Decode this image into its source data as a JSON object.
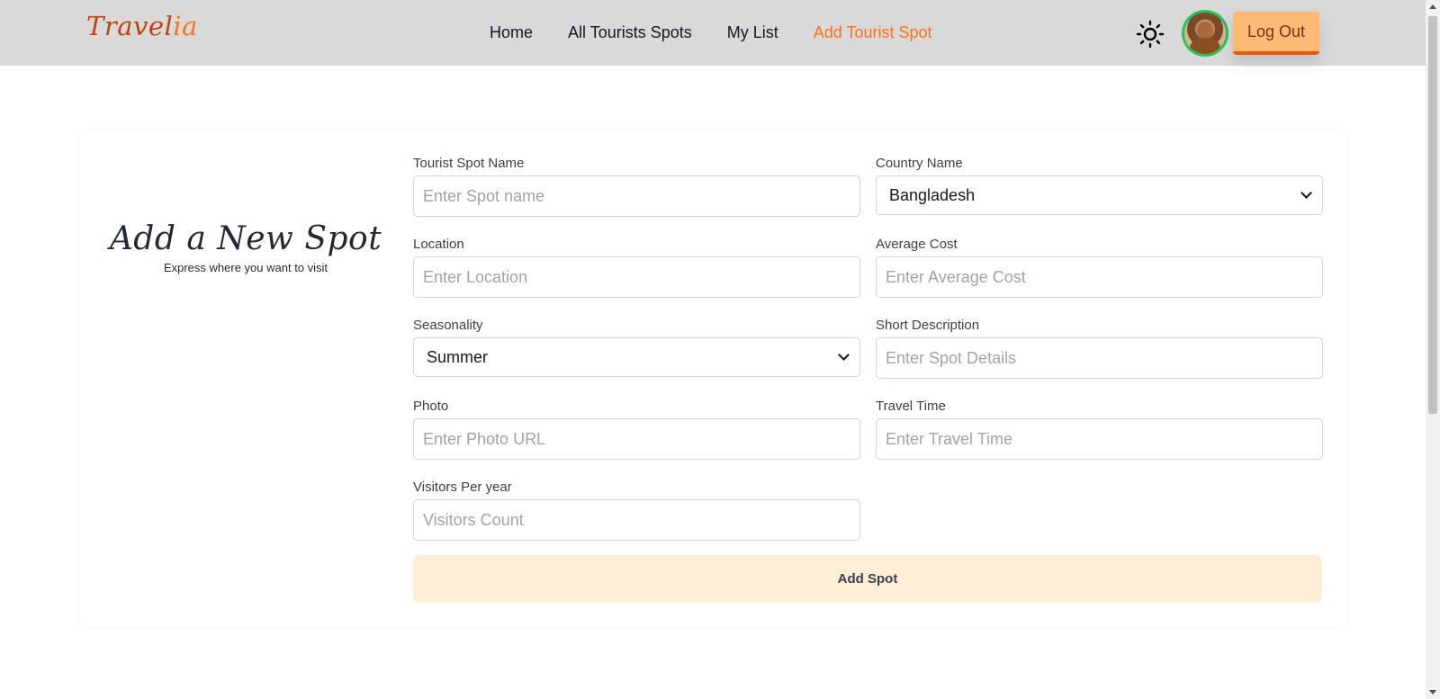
{
  "header": {
    "logo_text_main": "Travel",
    "logo_text_accent": "ia",
    "nav": [
      {
        "label": "Home"
      },
      {
        "label": "All Tourists Spots"
      },
      {
        "label": "My List"
      },
      {
        "label": "Add Tourist Spot"
      }
    ],
    "active_nav": "Add Tourist Spot",
    "theme_icon": "sun-icon",
    "logout_label": "Log Out"
  },
  "hero": {
    "title": "Add a New Spot",
    "subtitle": "Express where you want to visit"
  },
  "form": {
    "spot_name": {
      "label": "Tourist Spot Name",
      "placeholder": "Enter Spot name"
    },
    "country": {
      "label": "Country Name",
      "value": "Bangladesh"
    },
    "location": {
      "label": "Location",
      "placeholder": "Enter Location"
    },
    "average_cost": {
      "label": "Average Cost",
      "placeholder": "Enter Average Cost"
    },
    "seasonality": {
      "label": "Seasonality",
      "value": "Summer"
    },
    "short_description": {
      "label": "Short Description",
      "placeholder": "Enter Spot Details"
    },
    "photo": {
      "label": "Photo",
      "placeholder": "Enter Photo URL"
    },
    "travel_time": {
      "label": "Travel Time",
      "placeholder": "Enter Travel Time"
    },
    "visitors": {
      "label": "Visitors Per year",
      "placeholder": "Visitors Count"
    },
    "submit_label": "Add Spot"
  },
  "colors": {
    "navbar_bg": "#d9d9d9",
    "accent": "#f97316",
    "logout_bg": "#fdba74",
    "submit_bg": "#ffedd5",
    "avatar_ring": "#22c55e"
  }
}
